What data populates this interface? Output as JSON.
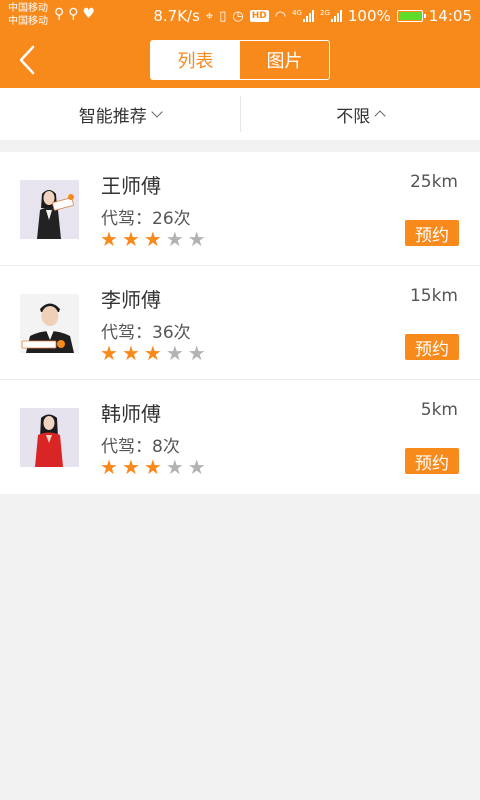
{
  "status_bar": {
    "carrier_1": "中国移动",
    "carrier_2": "中国移动",
    "speed": "8.7K/s",
    "hd": "HD",
    "net_4g": "4G",
    "net_2g": "2G",
    "battery": "100%",
    "time": "14:05"
  },
  "nav": {
    "tabs": [
      {
        "label": "列表",
        "active": true
      },
      {
        "label": "图片",
        "active": false
      }
    ]
  },
  "filters": {
    "sort_label": "智能推荐",
    "range_label": "不限"
  },
  "drivers": [
    {
      "name": "王师傅",
      "distance": "25km",
      "drives": "代驾：26次",
      "rating": 3,
      "max_rating": 5,
      "book_label": "预约",
      "avatar": "female-driver-black-suit"
    },
    {
      "name": "李师傅",
      "distance": "15km",
      "drives": "代驾：36次",
      "rating": 3,
      "max_rating": 5,
      "book_label": "预约",
      "avatar": "male-driver-black-suit"
    },
    {
      "name": "韩师傅",
      "distance": "5km",
      "drives": "代驾：8次",
      "rating": 3,
      "max_rating": 5,
      "book_label": "预约",
      "avatar": "female-driver-red-suit"
    }
  ],
  "colors": {
    "accent": "#f88a1c",
    "star_on": "#f88a1c",
    "star_off": "#b3b3b3",
    "background": "#f2f2f2"
  }
}
